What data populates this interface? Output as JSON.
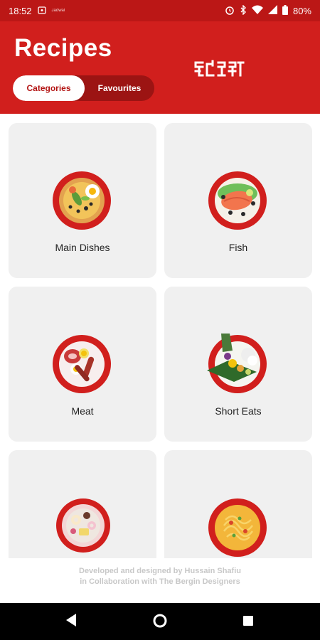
{
  "status_bar": {
    "time": "18:52",
    "tiny_label": "Jadwal",
    "battery": "80%",
    "icons": [
      "alarm-icon",
      "bluetooth-icon",
      "wifi-icon",
      "signal-icon",
      "battery-icon"
    ]
  },
  "header": {
    "title": "Recipes",
    "logo_text": "ꔽꕋꘆ",
    "tabs": [
      {
        "label": "Categories",
        "active": true
      },
      {
        "label": "Favourites",
        "active": false
      }
    ]
  },
  "categories": [
    {
      "label": "Main Dishes",
      "icon": "main-dishes-plate-icon"
    },
    {
      "label": "Fish",
      "icon": "fish-plate-icon"
    },
    {
      "label": "Meat",
      "icon": "meat-plate-icon"
    },
    {
      "label": "Short Eats",
      "icon": "short-eats-plate-icon"
    },
    {
      "label": "",
      "icon": "sweets-plate-icon"
    },
    {
      "label": "",
      "icon": "noodles-plate-icon"
    }
  ],
  "footer": {
    "line1": "Developed and designed by Hussain Shafiu",
    "line2": "in Collaboration with The Bergin Designers"
  },
  "nav": [
    "back-icon",
    "home-icon",
    "recents-icon"
  ],
  "colors": {
    "brand_red": "#d11f1d",
    "card_bg": "#f0f0f0"
  }
}
